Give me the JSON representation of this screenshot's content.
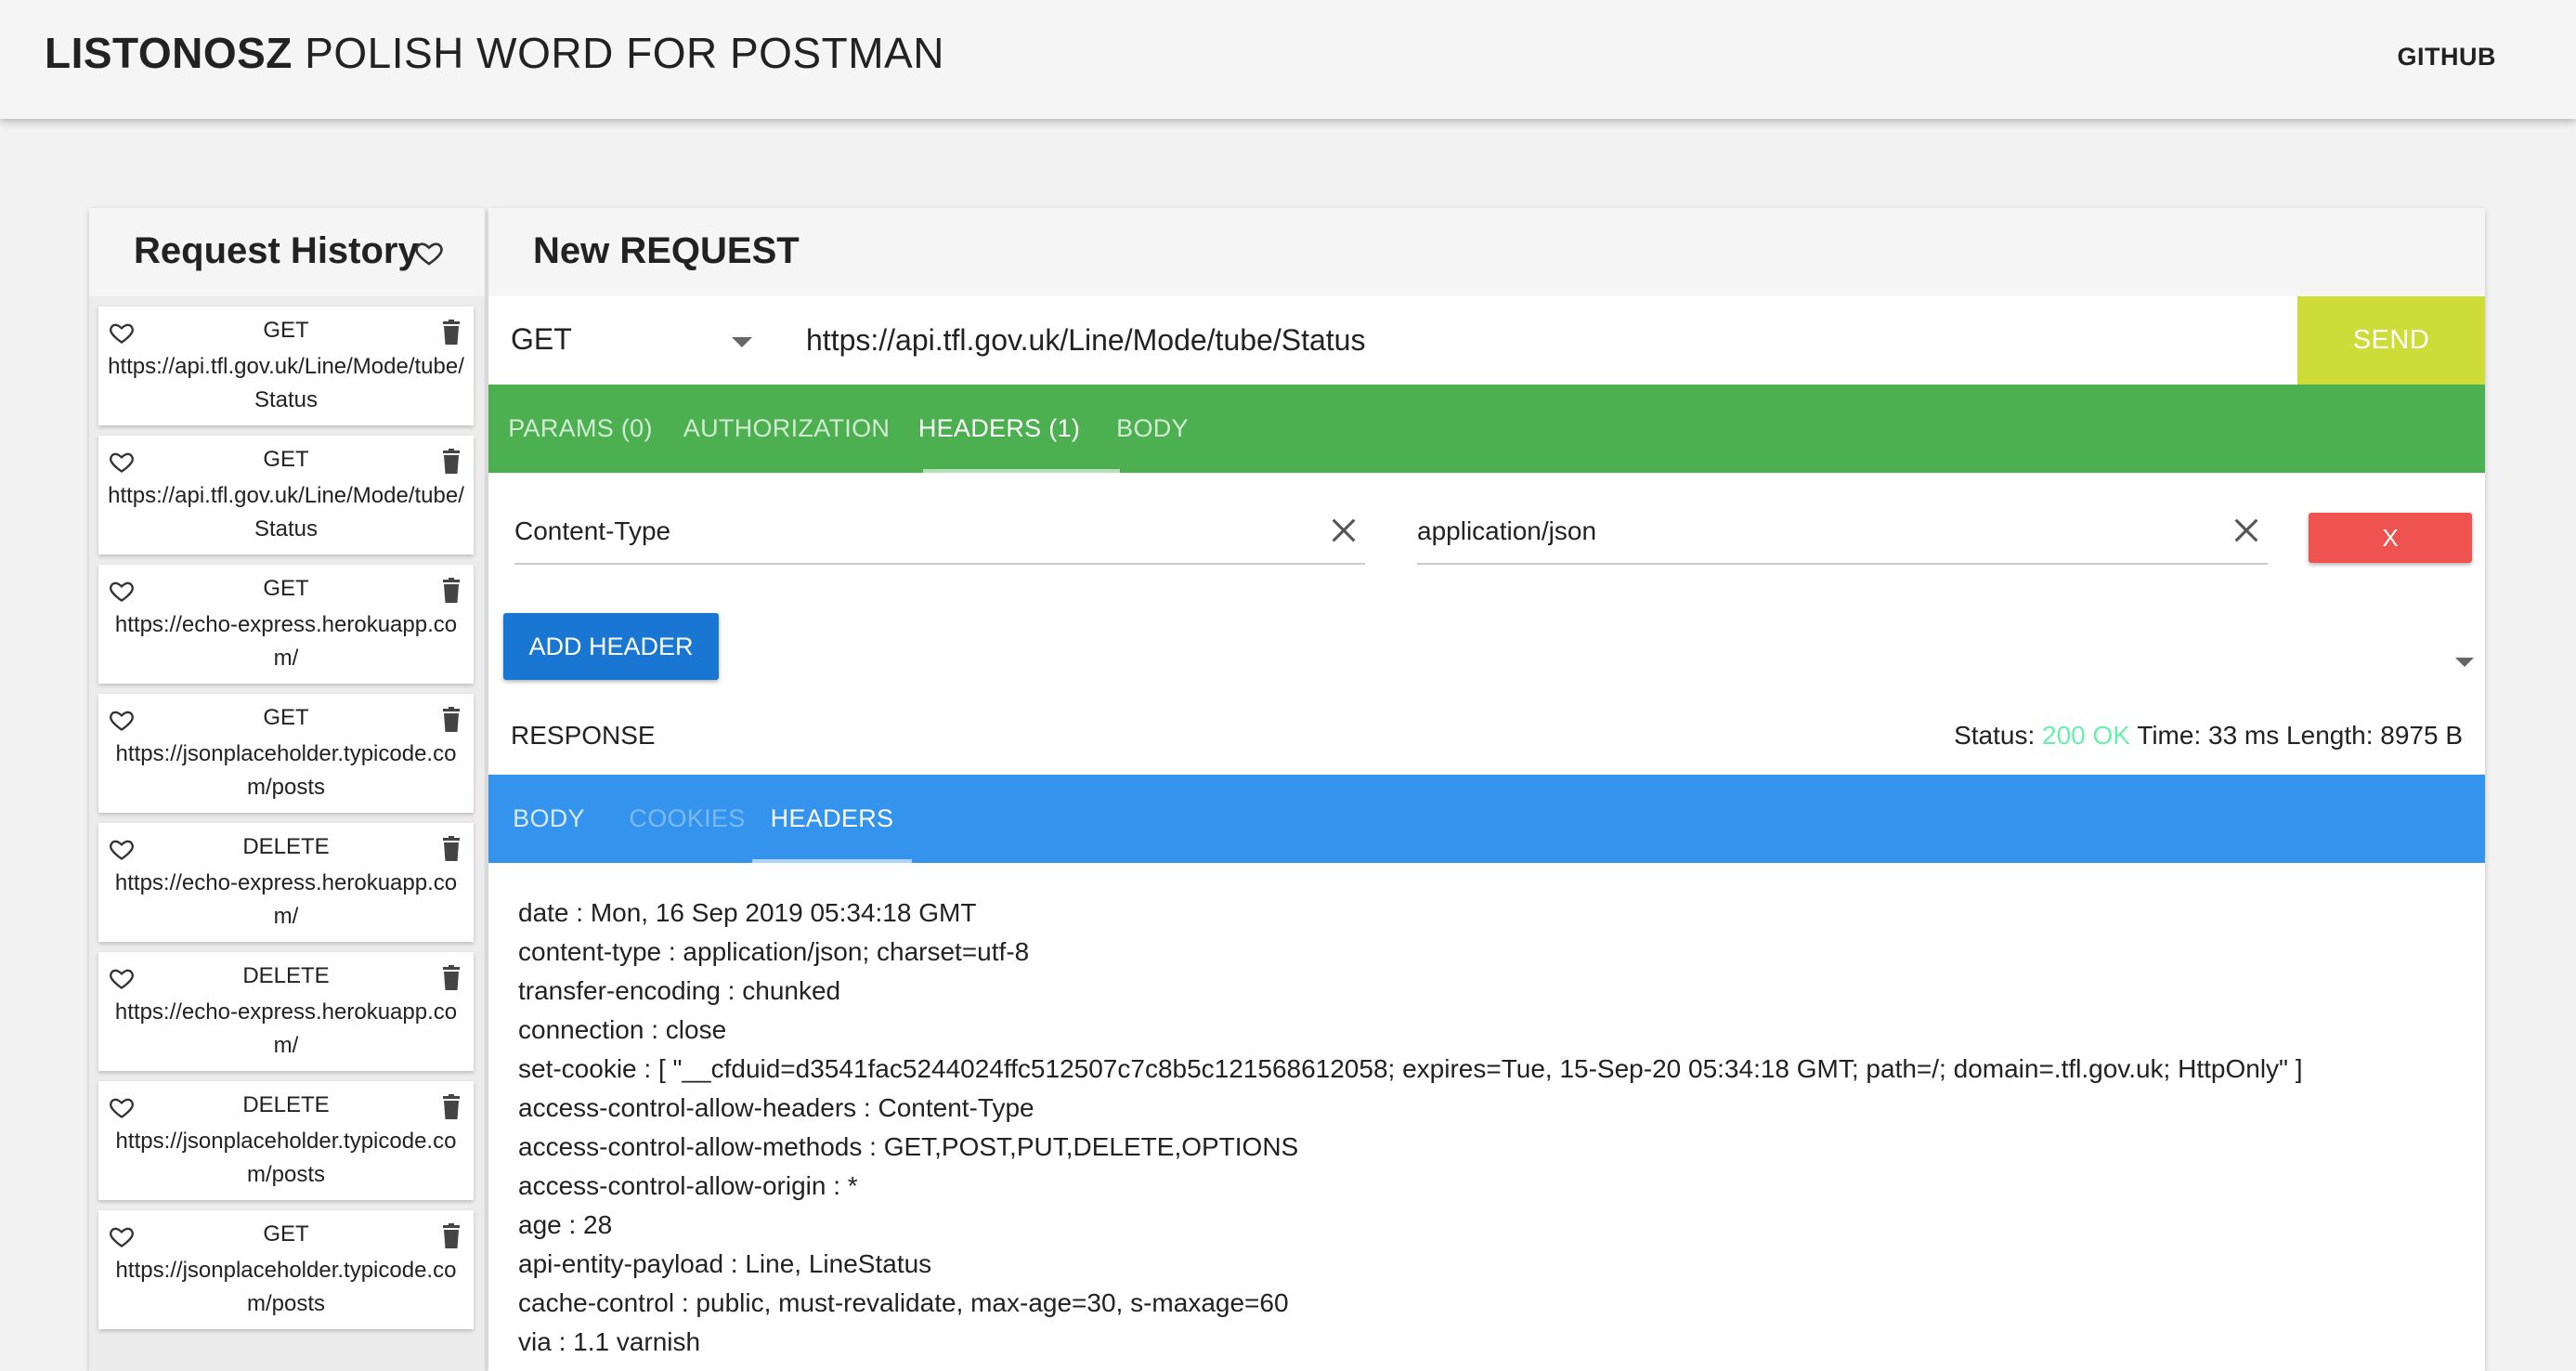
{
  "appbar": {
    "brand_bold": "LISTONOSZ",
    "brand_sub": "POLISH WORD FOR POSTMAN",
    "github": "GITHUB"
  },
  "history": {
    "title": "Request History",
    "items": [
      {
        "method": "GET",
        "url": "https://api.tfl.gov.uk/Line/Mode/tube/Status"
      },
      {
        "method": "GET",
        "url": "https://api.tfl.gov.uk/Line/Mode/tube/Status"
      },
      {
        "method": "GET",
        "url": "https://echo-express.herokuapp.com/"
      },
      {
        "method": "GET",
        "url": "https://jsonplaceholder.typicode.com/posts"
      },
      {
        "method": "DELETE",
        "url": "https://echo-express.herokuapp.com/"
      },
      {
        "method": "DELETE",
        "url": "https://echo-express.herokuapp.com/"
      },
      {
        "method": "DELETE",
        "url": "https://jsonplaceholder.typicode.com/posts"
      },
      {
        "method": "GET",
        "url": "https://jsonplaceholder.typicode.com/posts"
      }
    ]
  },
  "request": {
    "title": "New REQUEST",
    "method": "GET",
    "url": "https://api.tfl.gov.uk/Line/Mode/tube/Status",
    "send_label": "SEND",
    "tabs": [
      "PARAMS (0)",
      "AUTHORIZATION",
      "HEADERS (1)",
      "BODY"
    ],
    "active_tab": "HEADERS (1)",
    "header_key": "Content-Type",
    "header_value": "application/json",
    "remove_label": "X",
    "add_header_label": "ADD HEADER"
  },
  "response": {
    "label": "RESPONSE",
    "status_prefix": "Status:",
    "status_code": "200 OK",
    "time": "Time: 33 ms",
    "length": "Length: 8975 B",
    "tabs": [
      "BODY",
      "COOKIES",
      "HEADERS"
    ],
    "active_tab": "HEADERS",
    "headers": [
      "date : Mon, 16 Sep 2019 05:34:18 GMT",
      "content-type : application/json; charset=utf-8",
      "transfer-encoding : chunked",
      "connection : close",
      "set-cookie : [ \"__cfduid=d3541fac5244024ffc512507c7c8b5c121568612058; expires=Tue, 15-Sep-20 05:34:18 GMT; path=/; domain=.tfl.gov.uk; HttpOnly\" ]",
      "access-control-allow-headers : Content-Type",
      "access-control-allow-methods : GET,POST,PUT,DELETE,OPTIONS",
      "access-control-allow-origin : *",
      "age : 28",
      "api-entity-payload : Line, LineStatus",
      "cache-control : public, must-revalidate, max-age=30, s-maxage=60",
      "via : 1.1 varnish"
    ]
  },
  "colors": {
    "send": "#cddc39",
    "request_tabs": "#4caf50",
    "response_tabs": "#3494ed",
    "add_header": "#1976d2",
    "remove": "#ef5350",
    "status_ok": "#69f0ae"
  },
  "icons": {
    "favorite": "heart-icon",
    "delete": "trash-icon",
    "clear": "close-icon",
    "dropdown": "caret-down-icon"
  }
}
